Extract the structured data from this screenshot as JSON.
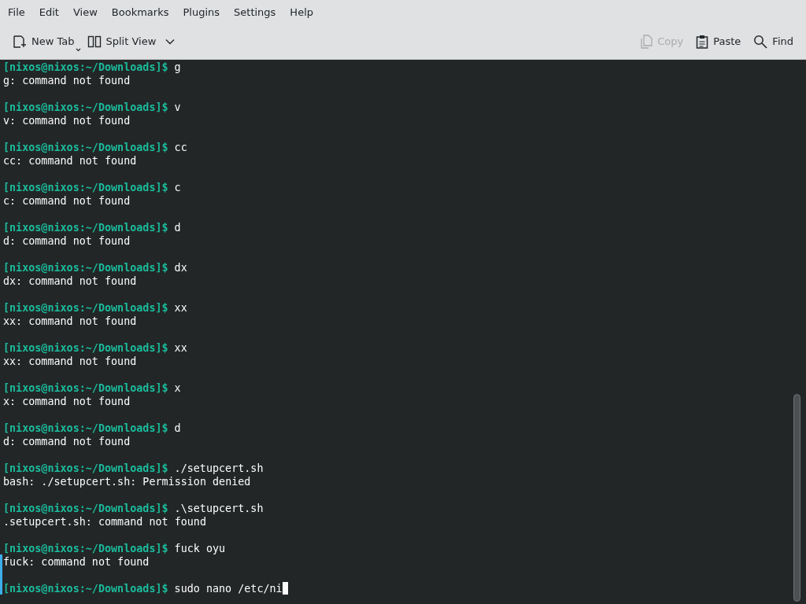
{
  "menu": [
    "File",
    "Edit",
    "View",
    "Bookmarks",
    "Plugins",
    "Settings",
    "Help"
  ],
  "toolbar": [
    {
      "kind": "new-tab",
      "label": "New Tab",
      "disabled": false
    },
    {
      "kind": "split-view",
      "label": "Split View",
      "disabled": false
    },
    {
      "kind": "copy",
      "label": "Copy",
      "disabled": true
    },
    {
      "kind": "paste",
      "label": "Paste",
      "disabled": false
    },
    {
      "kind": "find",
      "label": "Find",
      "disabled": false
    }
  ],
  "terminal": {
    "entries": [
      {
        "prompt": "[nixos@nixos:~/Downloads]$",
        "command": "g",
        "output": "g: command not found"
      },
      {
        "prompt": "[nixos@nixos:~/Downloads]$",
        "command": "v",
        "output": "v: command not found"
      },
      {
        "prompt": "[nixos@nixos:~/Downloads]$",
        "command": "cc",
        "output": "cc: command not found"
      },
      {
        "prompt": "[nixos@nixos:~/Downloads]$",
        "command": "c",
        "output": "c: command not found"
      },
      {
        "prompt": "[nixos@nixos:~/Downloads]$",
        "command": "d",
        "output": "d: command not found"
      },
      {
        "prompt": "[nixos@nixos:~/Downloads]$",
        "command": "dx",
        "output": "dx: command not found"
      },
      {
        "prompt": "[nixos@nixos:~/Downloads]$",
        "command": "xx",
        "output": "xx: command not found"
      },
      {
        "prompt": "[nixos@nixos:~/Downloads]$",
        "command": "xx",
        "output": "xx: command not found"
      },
      {
        "prompt": "[nixos@nixos:~/Downloads]$",
        "command": "x",
        "output": "x: command not found"
      },
      {
        "prompt": "[nixos@nixos:~/Downloads]$",
        "command": "d",
        "output": "d: command not found"
      },
      {
        "prompt": "[nixos@nixos:~/Downloads]$",
        "command": "./setupcert.sh",
        "output": "bash: ./setupcert.sh: Permission denied"
      },
      {
        "prompt": "[nixos@nixos:~/Downloads]$",
        "command": ".\\setupcert.sh",
        "output": ".setupcert.sh: command not found"
      },
      {
        "prompt": "[nixos@nixos:~/Downloads]$",
        "command": "fuck oyu",
        "output": "fuck: command not found"
      },
      {
        "prompt": "[nixos@nixos:~/Downloads]$",
        "command": "sudo nano /etc/ni"
      }
    ]
  }
}
